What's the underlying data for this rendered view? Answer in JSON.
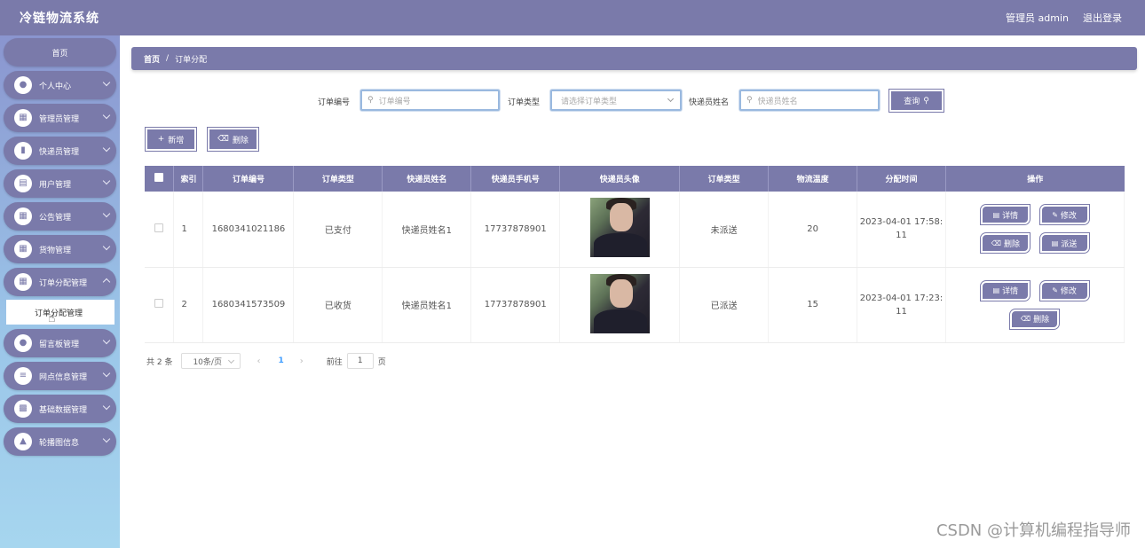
{
  "app": {
    "title": "冷链物流系统",
    "admin_label": "管理员 admin",
    "logout_label": "退出登录"
  },
  "sidebar": {
    "home_label": "首页",
    "items": [
      {
        "label": "个人中心",
        "icon": "user-icon"
      },
      {
        "label": "管理员管理",
        "icon": "grid-icon"
      },
      {
        "label": "快递员管理",
        "icon": "tablet-icon"
      },
      {
        "label": "用户管理",
        "icon": "document-icon"
      },
      {
        "label": "公告管理",
        "icon": "grid-icon"
      },
      {
        "label": "货物管理",
        "icon": "grid-icon"
      },
      {
        "label": "订单分配管理",
        "icon": "grid-icon",
        "open": true
      },
      {
        "label": "留言板管理",
        "icon": "user-icon"
      },
      {
        "label": "网点信息管理",
        "icon": "sliders-icon"
      },
      {
        "label": "基础数据管理",
        "icon": "monitor-icon"
      },
      {
        "label": "轮播图信息",
        "icon": "chart-icon"
      }
    ],
    "sub_item": "订单分配管理"
  },
  "breadcrumb": {
    "home": "首页",
    "separator": "/",
    "current": "订单分配"
  },
  "search": {
    "order_no_label": "订单编号",
    "order_no_placeholder": "订单编号",
    "order_type_label": "订单类型",
    "order_type_placeholder": "请选择订单类型",
    "courier_name_label": "快递员姓名",
    "courier_name_placeholder": "快递员姓名",
    "query_label": "查询"
  },
  "actions": {
    "add_label": "新增",
    "delete_label": "删除"
  },
  "table": {
    "headers": [
      "",
      "索引",
      "订单编号",
      "订单类型",
      "快递员姓名",
      "快递员手机号",
      "快递员头像",
      "订单类型",
      "物流温度",
      "分配时间",
      "操作"
    ],
    "rows": [
      {
        "index": "1",
        "order_no": "1680341021186",
        "order_type": "已支付",
        "courier_name": "快递员姓名1",
        "courier_phone": "17737878901",
        "status": "未派送",
        "temperature": "20",
        "assign_time_line1": "2023-04-01 17:58:",
        "assign_time_line2": "11",
        "ops": [
          "详情",
          "修改",
          "删除",
          "派送"
        ]
      },
      {
        "index": "2",
        "order_no": "1680341573509",
        "order_type": "已收货",
        "courier_name": "快递员姓名1",
        "courier_phone": "17737878901",
        "status": "已派送",
        "temperature": "15",
        "assign_time_line1": "2023-04-01 17:23:",
        "assign_time_line2": "11",
        "ops": [
          "详情",
          "修改",
          "删除"
        ]
      }
    ]
  },
  "pagination": {
    "total": "共 2 条",
    "page_size": "10条/页",
    "prev": "‹",
    "current": "1",
    "next": "›",
    "goto_prefix": "前往",
    "goto_value": "1",
    "goto_suffix": "页"
  },
  "watermark": "CSDN @计算机编程指导师",
  "colors": {
    "primary": "#7a7aaa",
    "sidebar_gradient_top": "#8a95cf",
    "sidebar_gradient_bottom": "#a6d6ef",
    "active_page": "#409eff"
  }
}
